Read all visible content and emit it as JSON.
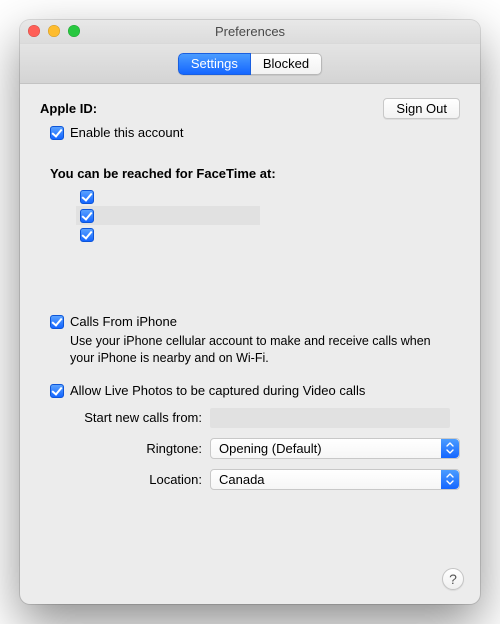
{
  "window": {
    "title": "Preferences"
  },
  "tabs": {
    "settings": "Settings",
    "blocked": "Blocked"
  },
  "appleId": {
    "label": "Apple ID:",
    "value": ""
  },
  "signOut": "Sign Out",
  "enableAccount": "Enable this account",
  "reachHeader": "You can be reached for FaceTime at:",
  "reachItems": [
    {
      "label": "",
      "checked": true
    },
    {
      "label": "",
      "checked": true
    },
    {
      "label": "",
      "checked": true
    }
  ],
  "callsFromIphone": {
    "label": "Calls From iPhone",
    "desc": "Use your iPhone cellular account to make and receive calls when your iPhone is nearby and on Wi-Fi."
  },
  "livePhotos": "Allow Live Photos to be captured during Video calls",
  "startCalls": {
    "label": "Start new calls from:",
    "value": ""
  },
  "ringtone": {
    "label": "Ringtone:",
    "value": "Opening (Default)"
  },
  "location": {
    "label": "Location:",
    "value": "Canada"
  },
  "helpTooltip": "?"
}
